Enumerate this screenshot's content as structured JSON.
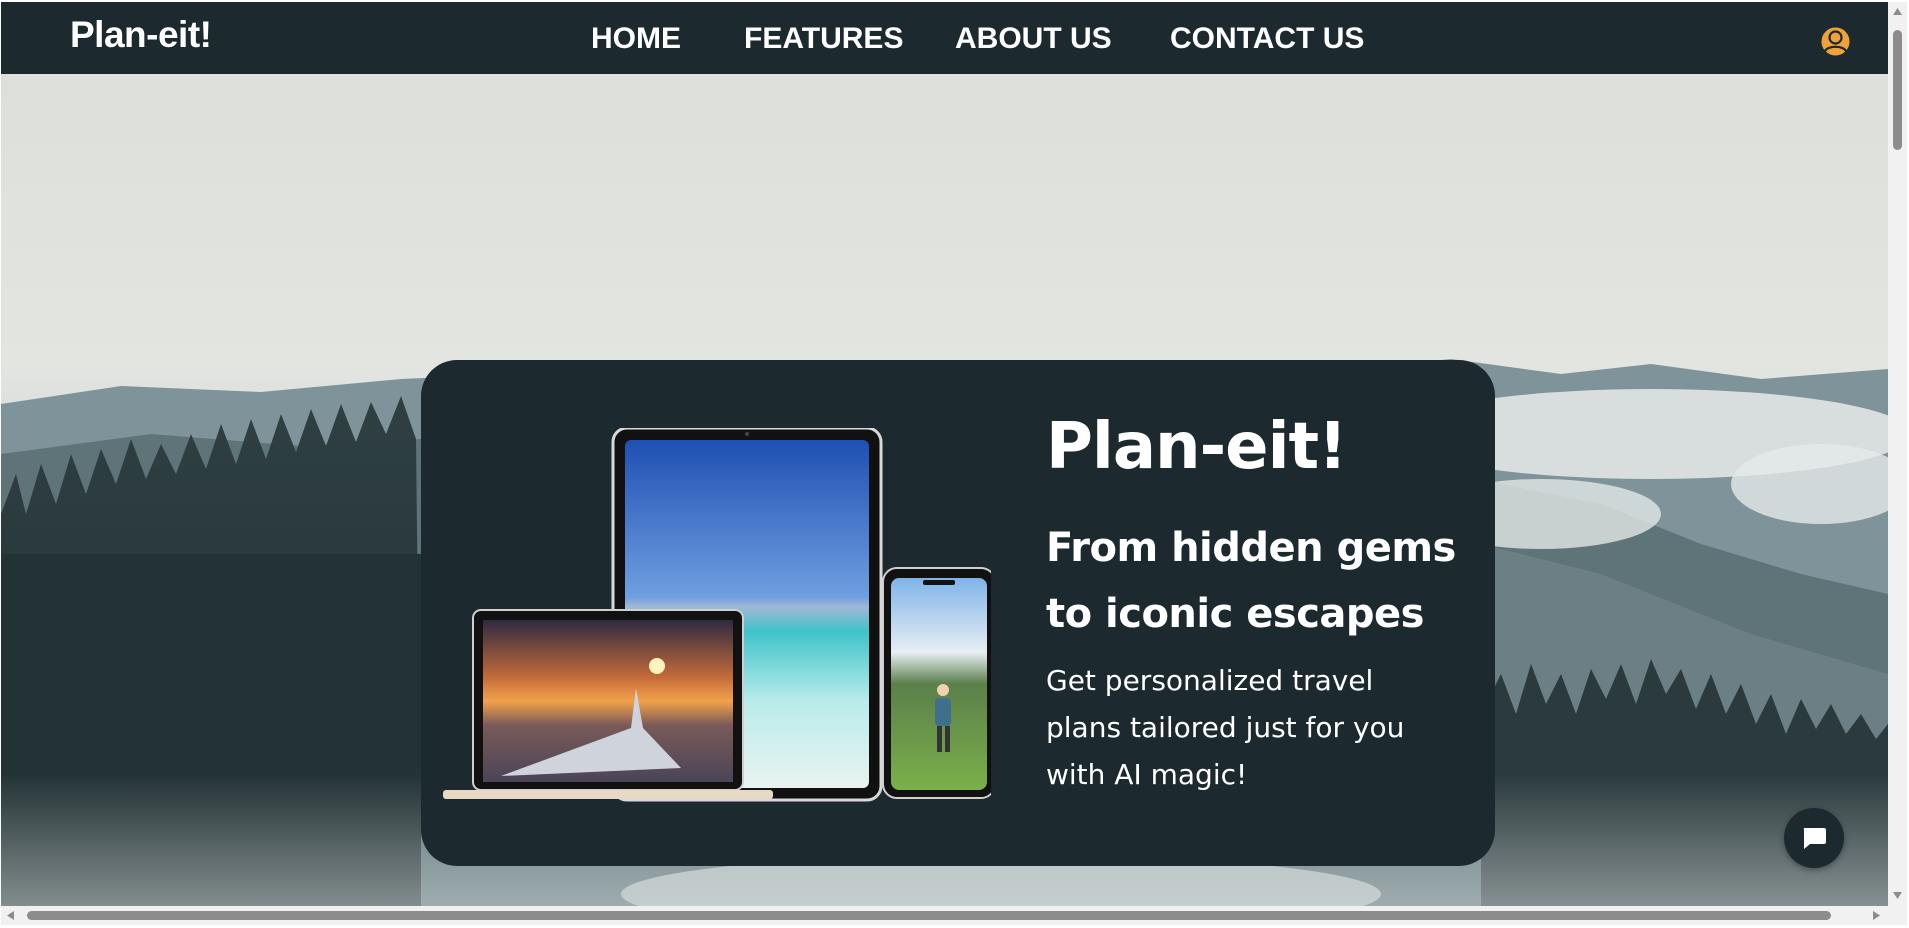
{
  "nav": {
    "brand": "Plan-eit!",
    "links": [
      "HOME",
      "FEATURES",
      "ABOUT US",
      "CONTACT US"
    ],
    "avatar_icon": "user-circle-icon"
  },
  "hero": {
    "title": "Plan-eit!",
    "tagline": "From hidden gems to iconic escapes",
    "description": "Get personalized travel plans tailored just for you with AI magic!"
  },
  "chat": {
    "icon": "chat-bubble-icon"
  },
  "colors": {
    "nav_bg": "#1c2a30",
    "card_bg": "#1c2a30",
    "text": "#ffffff",
    "avatar": "#f0a23a"
  }
}
